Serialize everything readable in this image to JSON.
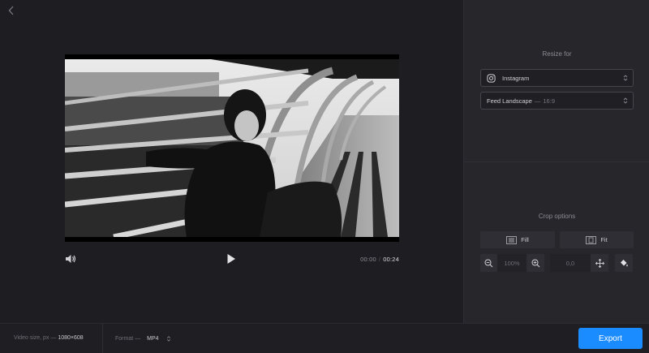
{
  "header": {
    "back_icon": "chevron-left-icon"
  },
  "player": {
    "current_time": "00:00",
    "separator": "/",
    "duration": "00:24",
    "volume_icon": "speaker-icon",
    "play_icon": "play-icon"
  },
  "resize": {
    "title": "Resize for",
    "platform": {
      "icon": "instagram-icon",
      "value": "Instagram"
    },
    "preset": {
      "value": "Feed Landscape",
      "sep": "—",
      "ratio": "16:9"
    }
  },
  "crop": {
    "title": "Crop options",
    "fill_label": "Fill",
    "fit_label": "Fit",
    "zoom_value": "100%",
    "position_value": "0,0",
    "zoom_out_icon": "zoom-out-icon",
    "zoom_in_icon": "zoom-in-icon",
    "move_icon": "move-icon",
    "fill_color_icon": "paint-bucket-icon"
  },
  "footer": {
    "video_size_label": "Video size, px —",
    "video_size_value": "1080×608",
    "format_label": "Format —",
    "format_value": "MP4",
    "export_label": "Export"
  },
  "colors": {
    "accent": "#1a8cff",
    "background": "#1c1c21",
    "panel": "#26262b"
  }
}
